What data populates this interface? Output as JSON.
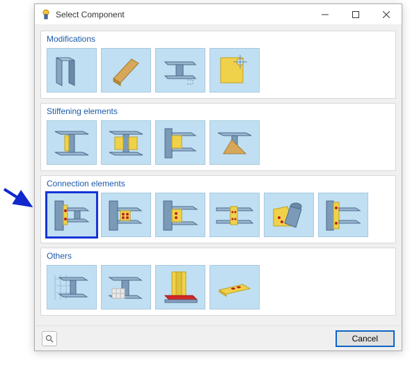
{
  "window": {
    "title": "Select Component"
  },
  "groups": {
    "modifications": {
      "title": "Modifications"
    },
    "stiffening": {
      "title": "Stiffening elements"
    },
    "connection": {
      "title": "Connection elements"
    },
    "others": {
      "title": "Others"
    }
  },
  "buttons": {
    "cancel": "Cancel"
  },
  "selected_item": "connection-end-plate"
}
